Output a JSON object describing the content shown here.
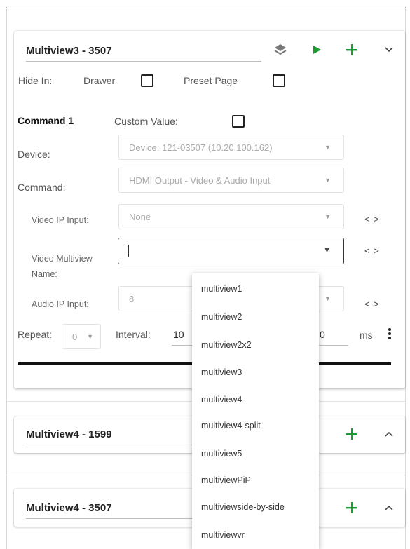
{
  "cards": [
    {
      "title": "Multiview3 - 3507",
      "hide_in_label": "Hide In:",
      "drawer_label": "Drawer",
      "preset_page_label": "Preset Page",
      "command_title": "Command 1",
      "custom_value_label": "Custom Value:",
      "device_label": "Device:",
      "device_value": "Device: 121-03507 (10.20.100.162)",
      "command_label": "Command:",
      "command_value": "HDMI Output - Video & Audio Input",
      "video_ip_input_label": "Video IP Input:",
      "video_ip_input_value": "None",
      "video_multiview_name_label_1": "Video Multiview",
      "video_multiview_name_label_2": "Name:",
      "video_multiview_name_value": "",
      "audio_ip_input_label": "Audio IP Input:",
      "audio_ip_input_value": "8",
      "repeat_label": "Repeat:",
      "repeat_value": "0",
      "interval_label": "Interval:",
      "interval_value": "10",
      "interval_value_tail": "0",
      "ms_label": "ms"
    },
    {
      "title": "Multiview4 - 1599"
    },
    {
      "title": "Multiview4 - 3507"
    }
  ],
  "dropdown": {
    "options": [
      "multiview1",
      "multiview2",
      "multiview2x2",
      "multiview3",
      "multiview4",
      "multiview4-split",
      "multiview5",
      "multiviewPiP",
      "multiviewside-by-side",
      "multiviewvr"
    ]
  },
  "icons": {
    "layers": "layers-icon",
    "play": "play-icon",
    "add": "plus-icon",
    "collapse": "chevron-down-icon",
    "expand": "chevron-up-icon",
    "code": "code-brackets-icon",
    "more": "more-vert-icon",
    "caret": "caret-down-icon"
  },
  "colors": {
    "accent_green": "#1a9c2f",
    "layers_gray": "#777777"
  }
}
